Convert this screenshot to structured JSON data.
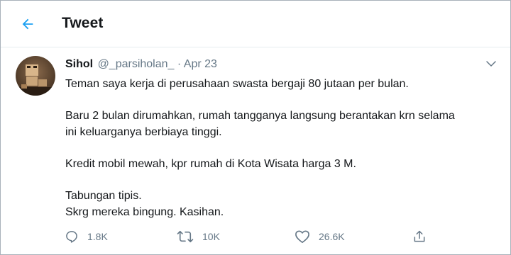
{
  "header": {
    "title": "Tweet",
    "back_icon": "arrow-left-icon",
    "accent": "#1da1f2"
  },
  "tweet": {
    "author_name": "Sihol",
    "handle": "@_parsiholan_",
    "separator": "·",
    "date": "Apr 23",
    "paragraphs": [
      [
        "Teman saya kerja di perusahaan swasta bergaji 80 jutaan per bulan."
      ],
      [
        "Baru 2 bulan dirumahkan, rumah tangganya langsung berantakan krn selama",
        "ini keluarganya berbiaya tinggi."
      ],
      [
        "Kredit mobil mewah, kpr rumah di Kota Wisata harga 3 M."
      ],
      [
        "Tabungan tipis.",
        "Skrg mereka bingung. Kasihan."
      ]
    ]
  },
  "actions": {
    "reply_count": "1.8K",
    "retweet_count": "10K",
    "like_count": "26.6K"
  },
  "colors": {
    "text": "#14171a",
    "secondary": "#657786",
    "divider": "#e6ecf0"
  }
}
